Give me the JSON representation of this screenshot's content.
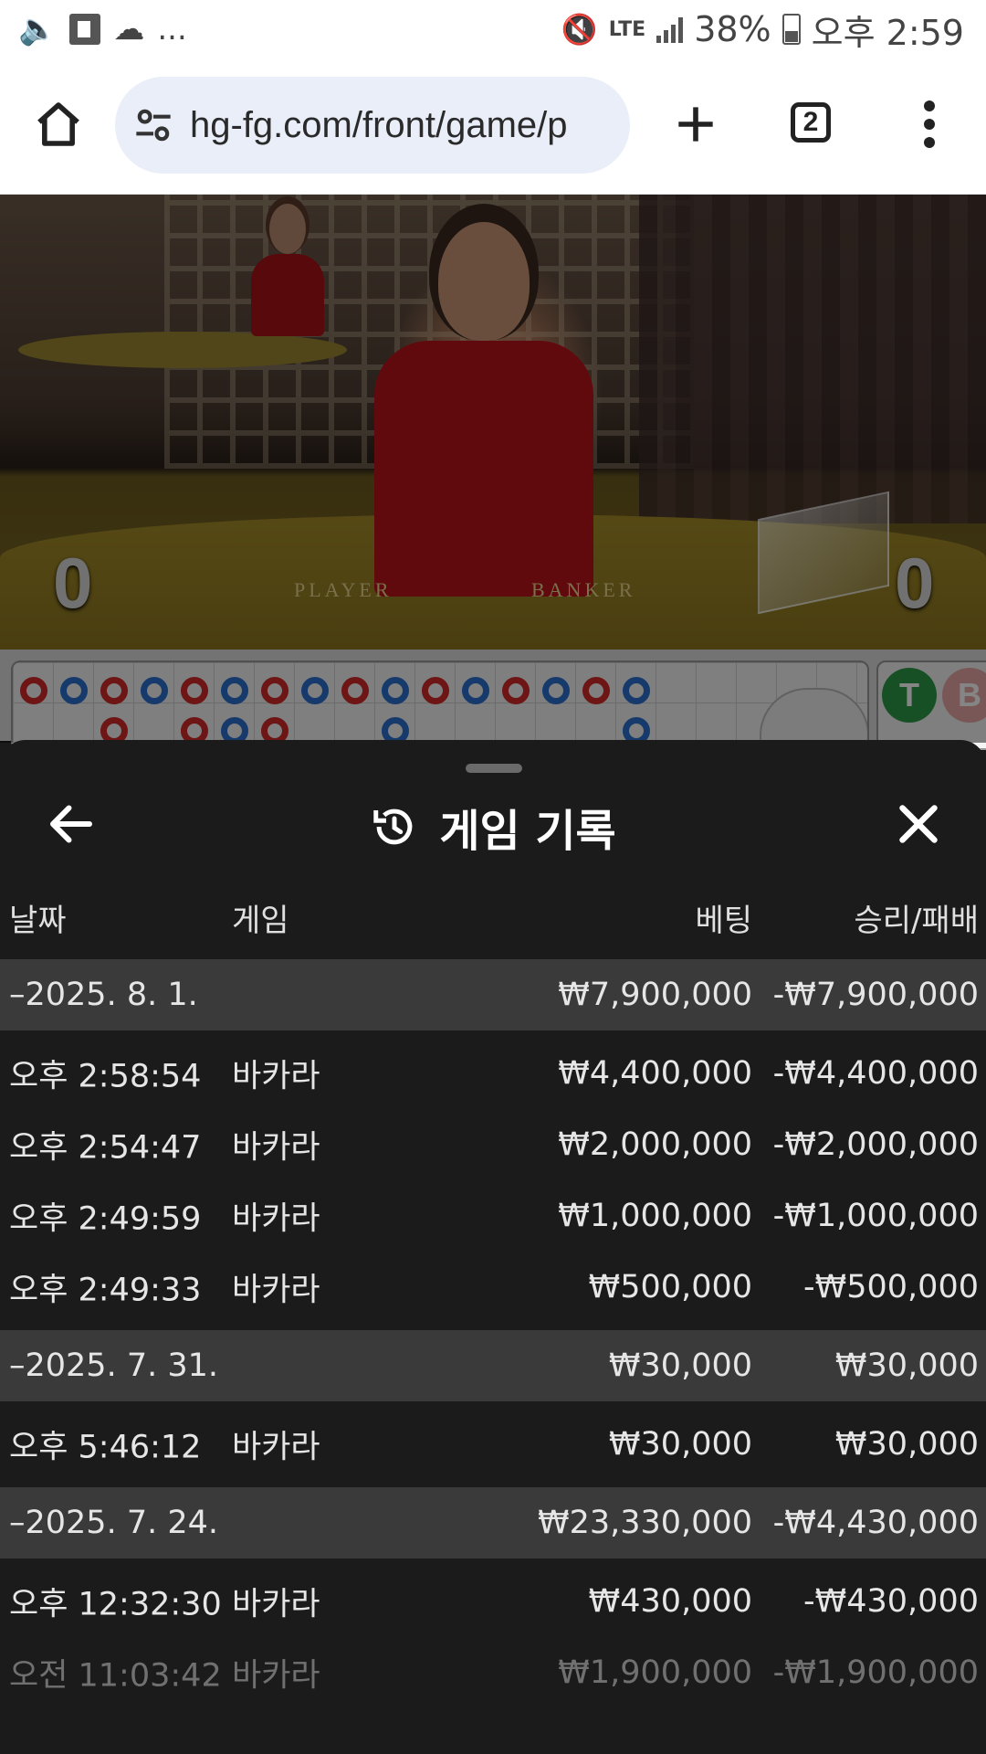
{
  "status_bar": {
    "left_more": "...",
    "network": "LTE",
    "battery": "38%",
    "time": "오후 2:59"
  },
  "browser": {
    "url": "hg-fg.com/front/game/p",
    "tab_count": "2"
  },
  "video": {
    "player_score": "0",
    "banker_score": "0",
    "table_labels": [
      "PLAYER",
      "BANKER"
    ]
  },
  "roadmap": {
    "side_labels": [
      "T",
      "B"
    ]
  },
  "sheet": {
    "title": "게임 기록",
    "columns": {
      "date": "날짜",
      "game": "게임",
      "bet": "베팅",
      "win_loss": "승리/패배"
    },
    "groups": [
      {
        "date": "–2025. 8. 1.",
        "bet": "₩7,900,000",
        "win_loss": "-₩7,900,000",
        "rows": [
          {
            "time": "오후 2:58:54",
            "game": "바카라",
            "bet": "₩4,400,000",
            "win_loss": "-₩4,400,000"
          },
          {
            "time": "오후 2:54:47",
            "game": "바카라",
            "bet": "₩2,000,000",
            "win_loss": "-₩2,000,000"
          },
          {
            "time": "오후 2:49:59",
            "game": "바카라",
            "bet": "₩1,000,000",
            "win_loss": "-₩1,000,000"
          },
          {
            "time": "오후 2:49:33",
            "game": "바카라",
            "bet": "₩500,000",
            "win_loss": "-₩500,000"
          }
        ]
      },
      {
        "date": "–2025. 7. 31.",
        "bet": "₩30,000",
        "win_loss": "₩30,000",
        "rows": [
          {
            "time": "오후 5:46:12",
            "game": "바카라",
            "bet": "₩30,000",
            "win_loss": "₩30,000"
          }
        ]
      },
      {
        "date": "–2025. 7. 24.",
        "bet": "₩23,330,000",
        "win_loss": "-₩4,430,000",
        "rows": [
          {
            "time": "오후 12:32:30",
            "game": "바카라",
            "bet": "₩430,000",
            "win_loss": "-₩430,000"
          },
          {
            "time": "오전 11:03:42",
            "game": "바카라",
            "bet": "₩1,900,000",
            "win_loss": "-₩1,900,000"
          }
        ]
      }
    ]
  },
  "colors": {
    "player_blue": "#2d6fd2",
    "banker_red": "#d42a2a",
    "tie_green": "#2f9a4a",
    "sheet_bg": "#1b1b1b",
    "group_bg": "#3a3a3a"
  }
}
